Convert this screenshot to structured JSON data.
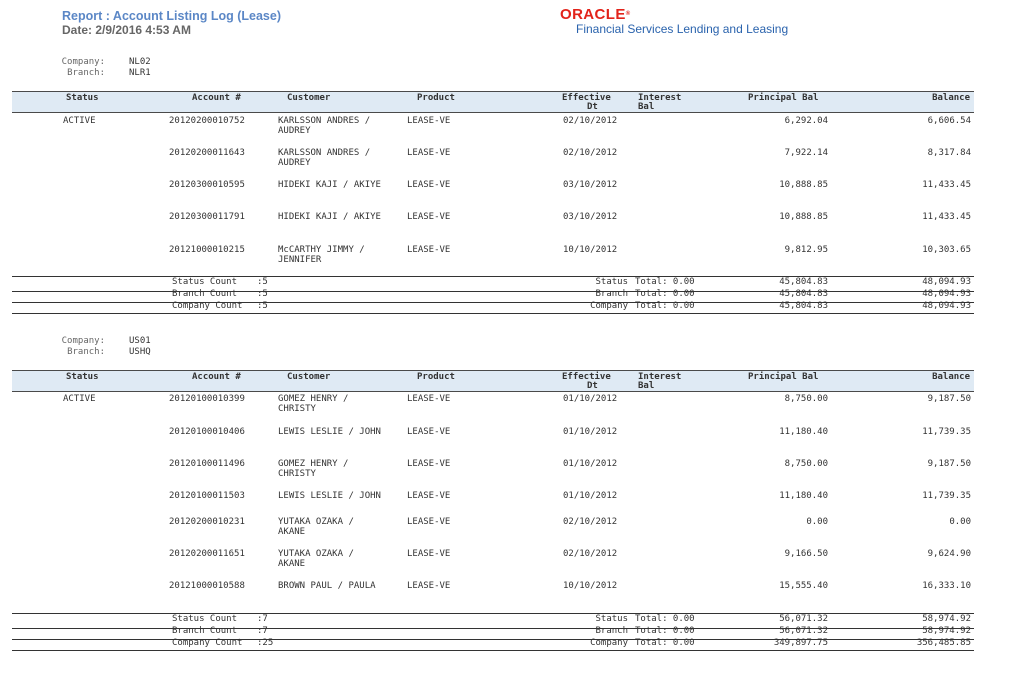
{
  "report": {
    "title": "Report : Account Listing Log (Lease)",
    "date": "Date: 2/9/2016  4:53 AM"
  },
  "brand": {
    "oracle": "ORACLE",
    "product": "Financial Services Lending and Leasing"
  },
  "labels": {
    "company": "Company:",
    "branch": "Branch:"
  },
  "columns": {
    "status": "Status",
    "account": "Account #",
    "customer": "Customer",
    "product": "Product",
    "effective1": "Effective",
    "effective2": "Dt",
    "interest1": "Interest",
    "interest2": "Bal",
    "principal": "Principal Bal",
    "balance": "Balance"
  },
  "sections": [
    {
      "company": "NL02",
      "branch": "NLR1",
      "rows": [
        {
          "status": "ACTIVE",
          "account": "20120200010752",
          "customer1": "KARLSSON ANDRES /",
          "customer2": "AUDREY",
          "product": "LEASE-VE",
          "effective": "02/10/2012",
          "principal": "6,292.04",
          "balance": "6,606.54"
        },
        {
          "status": "",
          "account": "20120200011643",
          "customer1": "KARLSSON ANDRES /",
          "customer2": "AUDREY",
          "product": "LEASE-VE",
          "effective": "02/10/2012",
          "principal": "7,922.14",
          "balance": "8,317.84"
        },
        {
          "status": "",
          "account": "20120300010595",
          "customer1": "HIDEKI KAJI / AKIYE",
          "customer2": "",
          "product": "LEASE-VE",
          "effective": "03/10/2012",
          "principal": "10,888.85",
          "balance": "11,433.45"
        },
        {
          "status": "",
          "account": "20120300011791",
          "customer1": "HIDEKI KAJI / AKIYE",
          "customer2": "",
          "product": "LEASE-VE",
          "effective": "03/10/2012",
          "principal": "10,888.85",
          "balance": "11,433.45"
        },
        {
          "status": "",
          "account": "20121000010215",
          "customer1": "McCARTHY JIMMY /",
          "customer2": "JENNIFER",
          "product": "LEASE-VE",
          "effective": "10/10/2012",
          "principal": "9,812.95",
          "balance": "10,303.65"
        }
      ],
      "totals": [
        {
          "label": "Status Count",
          "count": ":5",
          "tlabel": "Status",
          "tval": "Total: 0.00",
          "principal": "45,804.83",
          "balance": "48,094.93"
        },
        {
          "label": "Branch Count",
          "count": ":5",
          "tlabel": "Branch",
          "tval": "Total: 0.00",
          "principal": "45,804.83",
          "balance": "48,094.93"
        },
        {
          "label": "Company Count",
          "count": ":5",
          "tlabel": "Company",
          "tval": "Total: 0.00",
          "principal": "45,804.83",
          "balance": "48,094.93"
        }
      ]
    },
    {
      "company": "US01",
      "branch": "USHQ",
      "rows": [
        {
          "status": "ACTIVE",
          "account": "20120100010399",
          "customer1": "GOMEZ HENRY /",
          "customer2": "CHRISTY",
          "product": "LEASE-VE",
          "effective": "01/10/2012",
          "principal": "8,750.00",
          "balance": "9,187.50"
        },
        {
          "status": "",
          "account": "20120100010406",
          "customer1": "LEWIS LESLIE / JOHN",
          "customer2": "",
          "product": "LEASE-VE",
          "effective": "01/10/2012",
          "principal": "11,180.40",
          "balance": "11,739.35"
        },
        {
          "status": "",
          "account": "20120100011496",
          "customer1": "GOMEZ HENRY /",
          "customer2": "CHRISTY",
          "product": "LEASE-VE",
          "effective": "01/10/2012",
          "principal": "8,750.00",
          "balance": "9,187.50"
        },
        {
          "status": "",
          "account": "20120100011503",
          "customer1": "LEWIS LESLIE / JOHN",
          "customer2": "",
          "product": "LEASE-VE",
          "effective": "01/10/2012",
          "principal": "11,180.40",
          "balance": "11,739.35"
        },
        {
          "status": "",
          "account": "20120200010231",
          "customer1": "YUTAKA OZAKA /",
          "customer2": "AKANE",
          "product": "LEASE-VE",
          "effective": "02/10/2012",
          "principal": "0.00",
          "balance": "0.00"
        },
        {
          "status": "",
          "account": "20120200011651",
          "customer1": "YUTAKA OZAKA /",
          "customer2": "AKANE",
          "product": "LEASE-VE",
          "effective": "02/10/2012",
          "principal": "9,166.50",
          "balance": "9,624.90"
        },
        {
          "status": "",
          "account": "20121000010588",
          "customer1": "BROWN PAUL / PAULA",
          "customer2": "",
          "product": "LEASE-VE",
          "effective": "10/10/2012",
          "principal": "15,555.40",
          "balance": "16,333.10"
        }
      ],
      "totals": [
        {
          "label": "Status Count",
          "count": ":7",
          "tlabel": "Status",
          "tval": "Total: 0.00",
          "principal": "56,071.32",
          "balance": "58,974.92"
        },
        {
          "label": "Branch Count",
          "count": ":7",
          "tlabel": "Branch",
          "tval": "Total: 0.00",
          "principal": "56,071.32",
          "balance": "58,974.92"
        },
        {
          "label": "Company Count",
          "count": ":25",
          "tlabel": "Company",
          "tval": "Total: 0.00",
          "principal": "349,897.75",
          "balance": "356,485.85"
        }
      ]
    }
  ]
}
